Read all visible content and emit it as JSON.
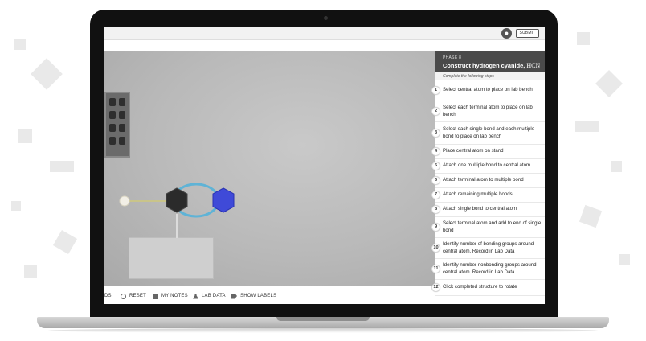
{
  "topbar": {
    "accessibility_icon": "person-accessibility-icon",
    "submit_label": "SUBMIT"
  },
  "panel": {
    "phase": "PHASE 8",
    "title_prefix": "Construct hydrogen cyanide, ",
    "title_formula": "HCN",
    "instruction": "Complete the following steps",
    "steps": [
      {
        "num": "1",
        "text": "Select central atom to place on lab bench"
      },
      {
        "num": "2",
        "text": "Select each terminal atom to place on lab bench"
      },
      {
        "num": "3",
        "text": "Select each single bond and each multiple bond to place on lab bench"
      },
      {
        "num": "4",
        "text": "Place central atom on stand"
      },
      {
        "num": "5",
        "text": "Attach one multiple bond to central atom"
      },
      {
        "num": "6",
        "text": "Attach terminal atom to multiple bond"
      },
      {
        "num": "7",
        "text": "Attach remaining multiple bonds"
      },
      {
        "num": "8",
        "text": "Attach single bond to central atom"
      },
      {
        "num": "9",
        "text": "Select terminal atom and add to end of single bond"
      },
      {
        "num": "10",
        "text": "Identify number of bonding groups around central atom. Record in Lab Data"
      },
      {
        "num": "11",
        "text": "Identify number nonbonding groups around central atom. Record in Lab Data"
      },
      {
        "num": "12",
        "text": "Click completed structure to rotate"
      }
    ]
  },
  "toolbar": {
    "partial_label": "DS",
    "reset_label": "RESET",
    "notes_label": "MY NOTES",
    "labdata_label": "LAB DATA",
    "labels_label": "SHOW LABELS"
  },
  "colors": {
    "panel_header": "#4a4a4a",
    "nitrogen_atom": "#3f4ad8",
    "carbon_atom": "#2b2b2b",
    "hydrogen_atom": "#f2efe6",
    "bond_ring": "#5fb3d6"
  }
}
